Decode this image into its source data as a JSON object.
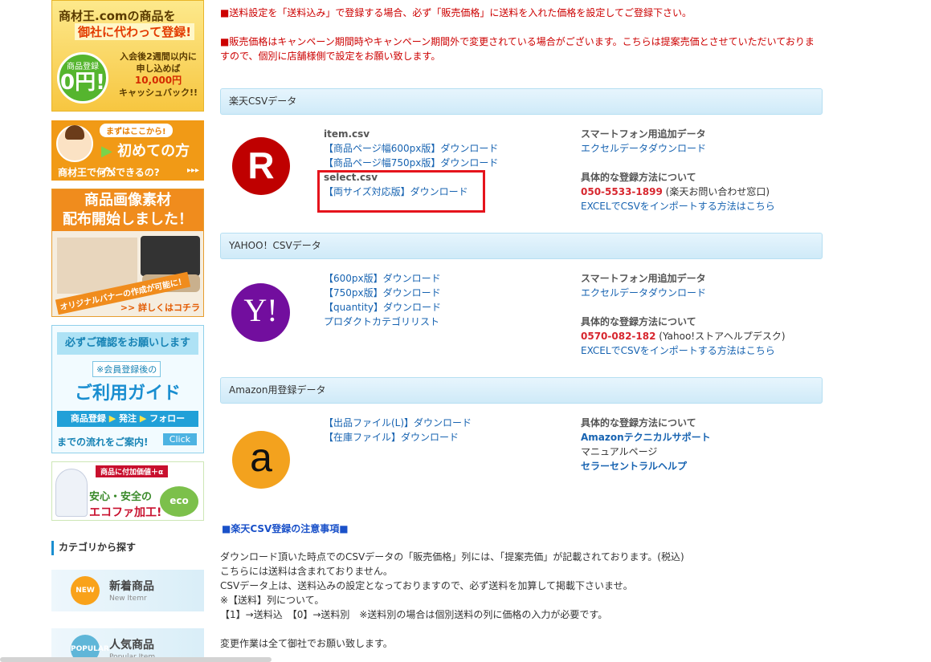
{
  "sidebar": {
    "banner1": {
      "line1": "商材王.comの商品を",
      "line2": "御社に代わって登録!",
      "badge_small": "商品登録",
      "badge_big": "0円!",
      "right1": "入会後2週間以内に",
      "right2": "申し込めば",
      "right3": "10,000円",
      "right4": "キャッシュバック!!"
    },
    "banner2": {
      "tag": "まずはここから!",
      "big": "初めての方へ",
      "small": "商材王で何ができるの?",
      "arrows": "▸▸▸"
    },
    "banner3": {
      "head1": "商品画像素材",
      "head2": "配布開始しました！",
      "note": "オリジナルバナーの作成が可能に！",
      "more": ">> 詳しくはコチラ"
    },
    "banner4": {
      "head": "必ずご確認をお願いします",
      "member": "※会員登録後の",
      "guide": "ご利用ガイド",
      "steps": [
        "商品登録",
        "発注",
        "フォロー"
      ],
      "flow": "までの流れをご案内!",
      "click": "Click"
    },
    "banner5": {
      "top": "商品に付加価値＋α",
      "mid": "安心・安全の",
      "bottom": "エコファ加工!",
      "eco": "eco"
    },
    "category_title": "カテゴリから探す",
    "categories": [
      {
        "badge": "NEW",
        "name": "新着商品",
        "sub": "New Itemr"
      },
      {
        "badge": "POPULAR",
        "name": "人気商品",
        "sub": "Popular Item"
      }
    ]
  },
  "notices": [
    "■送料設定を「送料込み」で登録する場合、必ず「販売価格」に送料を入れた価格を設定してご登録下さい。",
    "■販売価格はキャンペーン期間時やキャンペーン期間外で変更されている場合がございます。こちらは提案売価とさせていただいておりま",
    "すので、個別に店舗様側で設定をお願い致します。"
  ],
  "rakuten": {
    "section": "楽天CSVデータ",
    "logo": "R",
    "item_label": "item.csv",
    "item_links": [
      "【商品ページ幅600px版】ダウンロード",
      "【商品ページ幅750px版】ダウンロード"
    ],
    "select_label": "select.csv",
    "select_link": "【両サイズ対応版】ダウンロード",
    "sp_label": "スマートフォン用追加データ",
    "sp_link": "エクセルデータダウンロード",
    "method_label": "具体的な登録方法について",
    "phone": "050-5533-1899",
    "phone_note": "(楽天お問い合わせ窓口)",
    "excel_link": "EXCELでCSVをインポートする方法はこちら"
  },
  "yahoo": {
    "section": "YAHOO！CSVデータ",
    "logo": "Y!",
    "links": [
      "【600px版】ダウンロード",
      "【750px版】ダウンロード",
      "【quantity】ダウンロード",
      "プロダクトカテゴリリスト"
    ],
    "sp_label": "スマートフォン用追加データ",
    "sp_link": "エクセルデータダウンロード",
    "method_label": "具体的な登録方法について",
    "phone": "0570-082-182",
    "phone_note": "(Yahoo!ストアヘルプデスク)",
    "excel_link": "EXCELでCSVをインポートする方法はこちら"
  },
  "amazon": {
    "section": "Amazon用登録データ",
    "logo": "a",
    "links": [
      "【出品ファイル(L)】ダウンロード",
      "【在庫ファイル】ダウンロード"
    ],
    "method_label": "具体的な登録方法について",
    "support_link": "Amazonテクニカルサポート",
    "manual": "マニュアルページ",
    "help_link": "セラーセントラルヘルプ"
  },
  "caution": {
    "title": "■楽天CSV登録の注意事項■",
    "lines": [
      "ダウンロード頂いた時点でのCSVデータの「販売価格」列には、「提案売価」が記載されております。(税込)",
      "こちらには送料は含まれておりません。",
      "CSVデータ上は、送料込みの設定となっておりますので、必ず送料を加算して掲載下さいませ。",
      "※【送料】列について。",
      "【1】→送料込　【0】→送料別　※送料別の場合は個別送料の列に価格の入力が必要です。",
      "変更作業は全て御社でお願い致します。"
    ]
  },
  "colors": {
    "notice_red": "#cc0000",
    "link_blue": "#1763b1",
    "phone_red": "#d7262e",
    "highlight_red": "#e5141c",
    "rakuten_red": "#bf0000",
    "yahoo_purple": "#720e9e",
    "amazon_orange": "#f3a21e"
  }
}
